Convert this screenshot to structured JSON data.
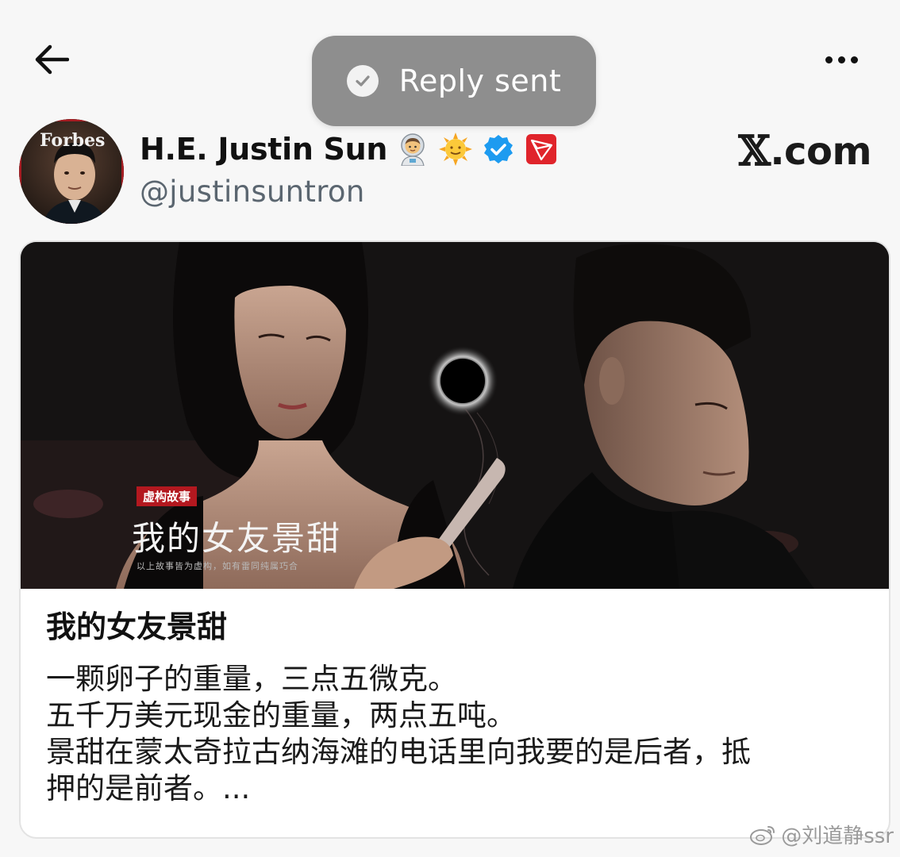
{
  "toast": {
    "text": "Reply sent"
  },
  "author": {
    "display_name": "H.E. Justin Sun",
    "handle": "@justinsuntron",
    "avatar_cover_text": "Forbes"
  },
  "brand": {
    "mark": "𝕏",
    "suffix": ".com"
  },
  "card": {
    "poster_tag": "虚构故事",
    "poster_title": "我的女友景甜",
    "poster_note": "以上故事皆为虚构，如有雷同纯属巧合",
    "title": "我的女友景甜",
    "body_lines": [
      "一颗卵子的重量，三点五微克。",
      "五千万美元现金的重量，两点五吨。",
      "景甜在蒙太奇拉古纳海滩的电话里向我要的是后者，抵",
      "押的是前者。..."
    ]
  },
  "watermark": {
    "text": "@刘道静ssr"
  },
  "colors": {
    "verified": "#1d9bf0",
    "tron": "#e0242b",
    "toast_bg": "#8e8e8e"
  },
  "icons": [
    "back-arrow-icon",
    "more-icon",
    "check-icon",
    "astronaut-emoji-icon",
    "sun-emoji-icon",
    "verified-badge-icon",
    "tron-logo-icon",
    "weibo-icon"
  ]
}
